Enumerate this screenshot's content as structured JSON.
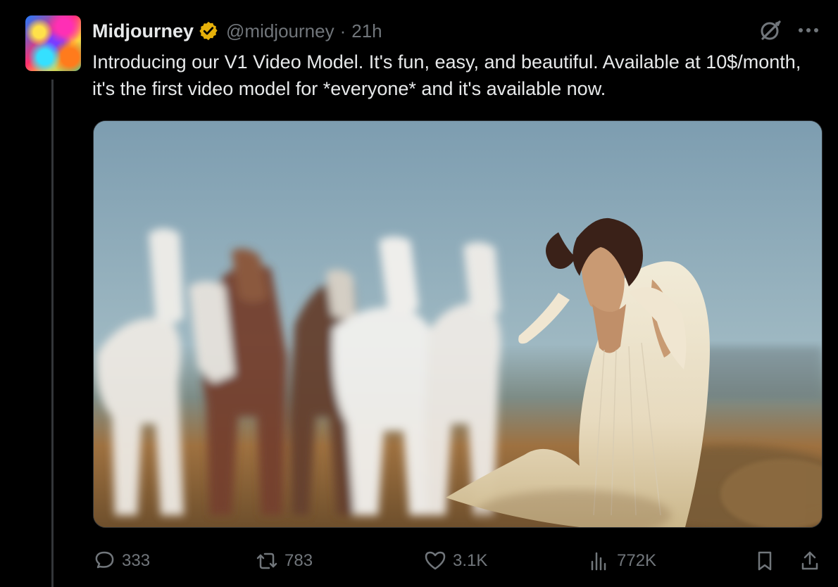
{
  "author": {
    "name": "Midjourney",
    "handle": "@midjourney",
    "time": "21h",
    "avatar_icon": "midjourney-avatar"
  },
  "tweet": {
    "text": "Introducing our V1 Video Model. It's fun, easy, and beautiful. Available at 10$/month, it's the first video model for *everyone* and it's available now."
  },
  "header_icons": {
    "verified": "verified-gold-badge",
    "grok": "grok-icon",
    "more": "more-icon"
  },
  "media": {
    "type": "video-thumbnail"
  },
  "actions": {
    "reply_count": "333",
    "repost_count": "783",
    "like_count": "3.1K",
    "view_count": "772K"
  },
  "colors": {
    "background": "#000000",
    "text": "#e7e9ea",
    "secondary": "#71767b",
    "border": "#2f3336",
    "verified": "#e7b10a"
  }
}
